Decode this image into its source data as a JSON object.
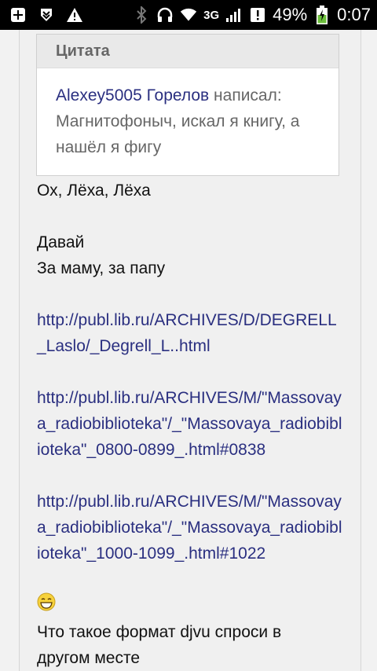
{
  "status_bar": {
    "network": "3G",
    "battery": "49%",
    "time": "0:07"
  },
  "quote": {
    "header": "Цитата",
    "author": "Alexey5005 Горелов",
    "said": " написал:",
    "text": "Магнитофоныч, искал я книгу, а нашёл я фигу"
  },
  "post": {
    "line1": "Ох, Лёха, Лёха",
    "line2": "Давай",
    "line3": "За маму, за папу",
    "link1": "http://publ.lib.ru/ARCHIVES/D/DEGRELL_Laslo/_Degrell_L..html",
    "link2": "http://publ.lib.ru/ARCHIVES/M/\"Massovaya_radiobiblioteka\"/_\"Massovaya_radiobiblioteka\"_0800-0899_.html#0838",
    "link3": "http://publ.lib.ru/ARCHIVES/M/\"Massovaya_radiobiblioteka\"/_\"Massovaya_radiobiblioteka\"_1000-1099_.html#1022",
    "footer": "Что такое формат djvu спроси в другом месте"
  },
  "colors": {
    "link": "#2a2f80",
    "quote_text": "#666666"
  }
}
